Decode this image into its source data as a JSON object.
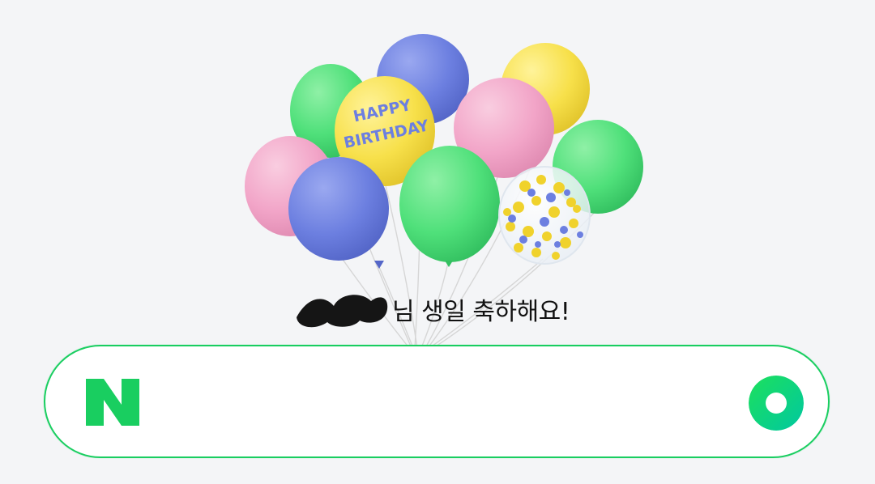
{
  "greeting": {
    "text": "님 생일 축하해요!"
  },
  "balloon_text": {
    "line1": "HAPPY",
    "line2": "BIRTHDAY"
  },
  "search": {
    "logo_letter": "N",
    "placeholder": "",
    "value": ""
  },
  "colors": {
    "brand_green": "#19ce60",
    "balloon_green": "#4fe07a",
    "balloon_blue": "#6c7fe0",
    "balloon_yellow": "#f7e04a",
    "balloon_pink": "#f2a5c8"
  },
  "icons": {
    "logo": "naver-n-icon",
    "voice": "green-dot-search-icon"
  }
}
